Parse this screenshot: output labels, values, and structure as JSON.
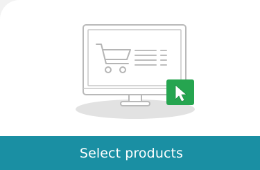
{
  "card": {
    "label": "Select products",
    "accent_color": "#1a8fa3",
    "cursor_badge_color": "#26a550",
    "illustration_icons": [
      "monitor-icon",
      "shopping-cart-icon",
      "product-list-icon",
      "cursor-icon"
    ]
  }
}
